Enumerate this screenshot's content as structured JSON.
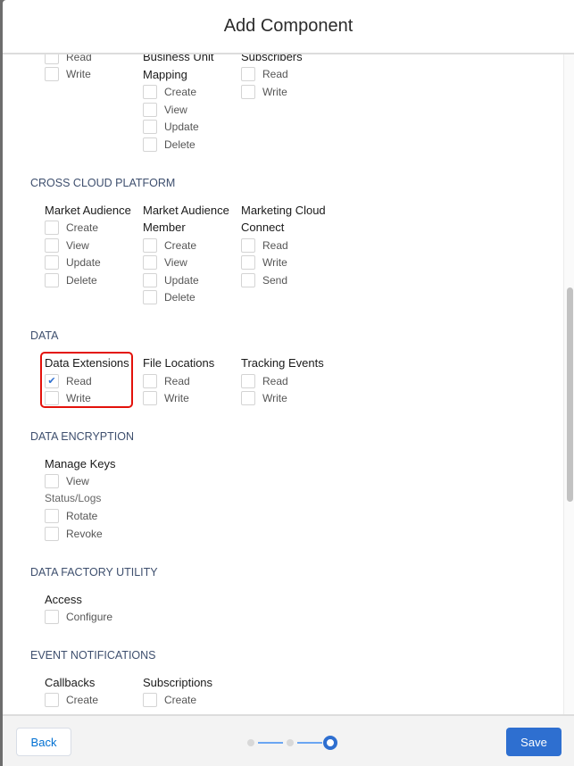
{
  "header": {
    "title": "Add Component"
  },
  "sections": [
    {
      "title": "",
      "groups": [
        {
          "heading": [
            ""
          ],
          "items": [
            {
              "type": "cb",
              "label": "Read",
              "checked": false
            },
            {
              "type": "cb",
              "label": "Write",
              "checked": false
            }
          ]
        },
        {
          "heading": [
            "Business Unit",
            "Mapping"
          ],
          "items": [
            {
              "type": "cb",
              "label": "Create"
            },
            {
              "type": "cb",
              "label": "View"
            },
            {
              "type": "cb",
              "label": "Update"
            },
            {
              "type": "cb",
              "label": "Delete"
            }
          ]
        },
        {
          "heading": [
            "Subscribers"
          ],
          "items": [
            {
              "type": "cb",
              "label": "Read"
            },
            {
              "type": "cb",
              "label": "Write"
            }
          ]
        }
      ]
    },
    {
      "title": "Cross Cloud Platform",
      "groups": [
        {
          "heading": [
            "Market Audience"
          ],
          "items": [
            {
              "type": "cb",
              "label": "Create"
            },
            {
              "type": "cb",
              "label": "View"
            },
            {
              "type": "cb",
              "label": "Update"
            },
            {
              "type": "cb",
              "label": "Delete"
            }
          ]
        },
        {
          "heading": [
            "Market Audience",
            "Member"
          ],
          "items": [
            {
              "type": "cb",
              "label": "Create"
            },
            {
              "type": "cb",
              "label": "View"
            },
            {
              "type": "cb",
              "label": "Update"
            },
            {
              "type": "cb",
              "label": "Delete"
            }
          ]
        },
        {
          "heading": [
            "Marketing Cloud",
            "Connect"
          ],
          "items": [
            {
              "type": "cb",
              "label": "Read"
            },
            {
              "type": "cb",
              "label": "Write"
            },
            {
              "type": "cb",
              "label": "Send"
            }
          ]
        }
      ]
    },
    {
      "title": "Data",
      "groups": [
        {
          "heading": [
            "Data Extensions"
          ],
          "highlighted": true,
          "items": [
            {
              "type": "cb",
              "label": "Read",
              "checked": true
            },
            {
              "type": "cb",
              "label": "Write"
            }
          ]
        },
        {
          "heading": [
            "File Locations"
          ],
          "items": [
            {
              "type": "cb",
              "label": "Read"
            },
            {
              "type": "cb",
              "label": "Write"
            }
          ]
        },
        {
          "heading": [
            "Tracking Events"
          ],
          "items": [
            {
              "type": "cb",
              "label": "Read"
            },
            {
              "type": "cb",
              "label": "Write"
            }
          ]
        }
      ]
    },
    {
      "title": "Data Encryption",
      "groups": [
        {
          "heading": [
            "Manage Keys"
          ],
          "items": [
            {
              "type": "cb",
              "label": "View"
            },
            {
              "type": "sub",
              "label": "Status/Logs"
            },
            {
              "type": "cb",
              "label": "Rotate"
            },
            {
              "type": "cb",
              "label": "Revoke"
            }
          ]
        }
      ]
    },
    {
      "title": "Data Factory Utility",
      "groups": [
        {
          "heading": [
            "Access"
          ],
          "items": [
            {
              "type": "cb",
              "label": "Configure"
            }
          ]
        }
      ]
    },
    {
      "title": "Event Notifications",
      "groups": [
        {
          "heading": [
            "Callbacks"
          ],
          "items": [
            {
              "type": "cb",
              "label": "Create"
            }
          ]
        },
        {
          "heading": [
            "Subscriptions"
          ],
          "items": [
            {
              "type": "cb",
              "label": "Create"
            }
          ]
        }
      ]
    }
  ],
  "footer": {
    "back_label": "Back",
    "save_label": "Save",
    "steps_total": 3,
    "current_step": 3
  },
  "colors": {
    "accent": "#2e6fd0",
    "highlight": "#e3120b"
  }
}
